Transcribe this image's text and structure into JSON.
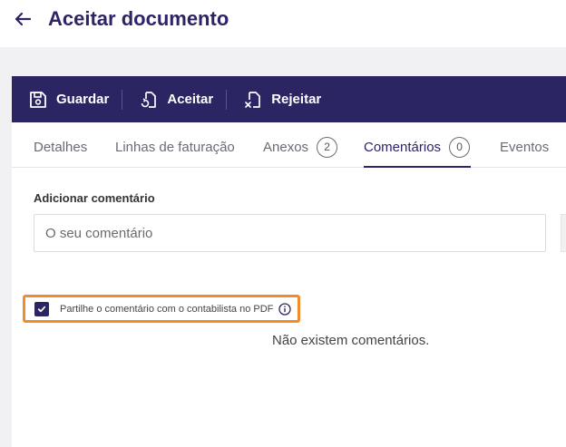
{
  "header": {
    "title": "Aceitar documento",
    "back_icon": "arrow-left-icon"
  },
  "toolbar": {
    "buttons": [
      {
        "label": "Guardar",
        "icon": "save-icon"
      },
      {
        "label": "Aceitar",
        "icon": "accept-document-icon"
      },
      {
        "label": "Rejeitar",
        "icon": "reject-document-icon"
      }
    ]
  },
  "tabs": [
    {
      "label": "Detalhes"
    },
    {
      "label": "Linhas de faturação"
    },
    {
      "label": "Anexos",
      "count": "2"
    },
    {
      "label": "Comentários",
      "count": "0",
      "active": true
    },
    {
      "label": "Eventos"
    }
  ],
  "comments": {
    "add_label": "Adicionar comentário",
    "input_placeholder": "O seu comentário",
    "input_value": "",
    "share_label": "Partilhe o comentário com o contabilista no PDF",
    "share_checked": true,
    "empty_message": "Não existem comentários."
  },
  "colors": {
    "brand": "#2b2563",
    "highlight": "#f08c2e"
  }
}
